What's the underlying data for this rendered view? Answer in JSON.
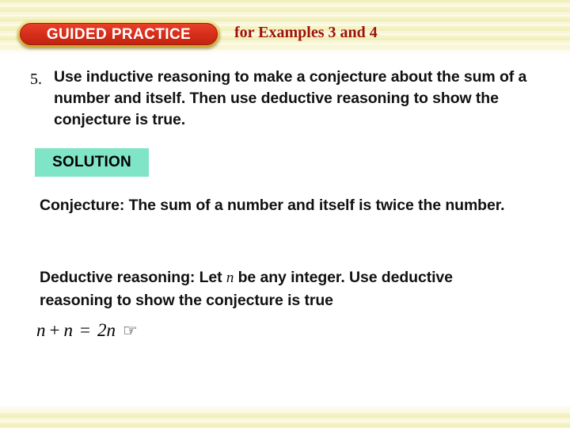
{
  "header": {
    "badge_label": "GUIDED PRACTICE",
    "note": "for Examples 3 and 4",
    "badge_color": "#d8301c",
    "badge_border_color": "#e8c85c",
    "note_color": "#9e1208"
  },
  "problem": {
    "number": "5.",
    "text": "Use inductive reasoning to make a conjecture about the sum of a number and itself. Then use deductive reasoning to show the conjecture is true."
  },
  "solution": {
    "label": "SOLUTION",
    "highlight_color": "#80e4c6",
    "conjecture_prefix": "Conjecture: The sum of a number and itself is twice the number.",
    "deductive_part1": "Deductive reasoning: Let ",
    "deductive_variable": "n",
    "deductive_part2": " be any integer. Use deductive reasoning to show the conjecture is true"
  },
  "equation": {
    "left_term_a": "n",
    "operator": "+",
    "left_term_b": "n",
    "equals": "=",
    "right_term": "2n",
    "pointer_glyph": "☞"
  }
}
